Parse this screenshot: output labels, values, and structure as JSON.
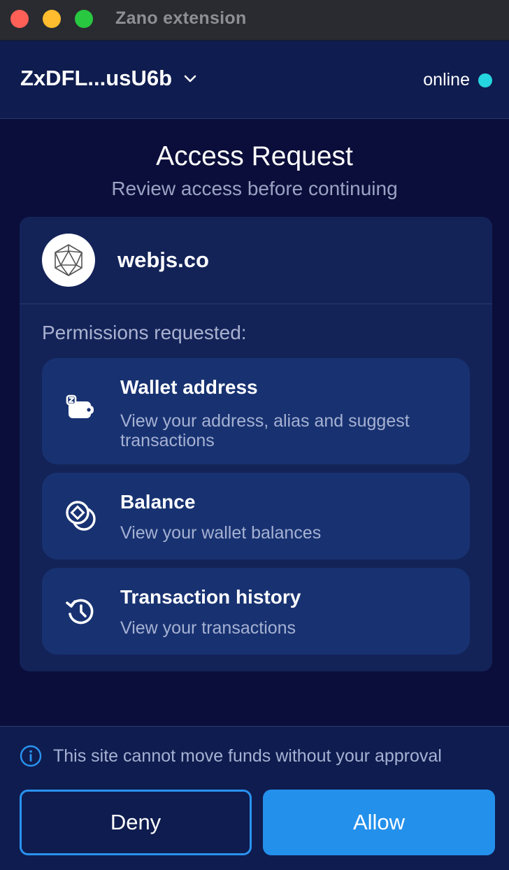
{
  "window": {
    "title": "Zano extension"
  },
  "header": {
    "account": "ZxDFL...usU6b",
    "status": "online",
    "status_color": "#25d6e0"
  },
  "page": {
    "title": "Access Request",
    "subtitle": "Review access before continuing"
  },
  "site": {
    "name": "webjs.co"
  },
  "permissions": {
    "heading": "Permissions requested:",
    "items": [
      {
        "icon": "wallet-icon",
        "title": "Wallet address",
        "description": "View your address, alias and suggest transactions"
      },
      {
        "icon": "coins-icon",
        "title": "Balance",
        "description": "View your wallet balances"
      },
      {
        "icon": "history-icon",
        "title": "Transaction history",
        "description": "View your transactions"
      }
    ]
  },
  "footer": {
    "notice": "This site cannot move funds without your approval",
    "deny_label": "Deny",
    "allow_label": "Allow"
  },
  "colors": {
    "accent": "#2390ec",
    "background": "#0b0e3a",
    "card": "#132358"
  }
}
